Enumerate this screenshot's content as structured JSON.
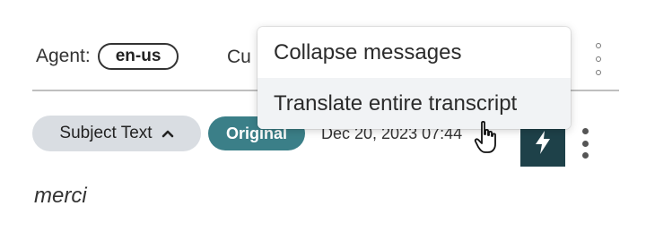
{
  "header": {
    "agent_label": "Agent:",
    "agent_language": "en-us",
    "customer_label_partial": "Cu"
  },
  "message": {
    "subject_label": "Subject Text",
    "original_label": "Original",
    "timestamp": "Dec 20, 2023 07:44",
    "body_text": "merci"
  },
  "menu": {
    "items": [
      {
        "label": "Collapse messages"
      },
      {
        "label": "Translate entire transcript"
      }
    ]
  },
  "icons": {
    "kebab_top": "more-vertical-outline-icon",
    "bolt": "lightning-bolt-icon",
    "kebab_message": "more-vertical-icon",
    "chevron": "chevron-up-icon",
    "cursor": "pointer-hand-cursor"
  },
  "colors": {
    "original_badge": "#3b7f88",
    "bolt_button": "#1e4149",
    "subject_chip": "#d9dde2",
    "menu_hover": "#f1f3f5"
  }
}
